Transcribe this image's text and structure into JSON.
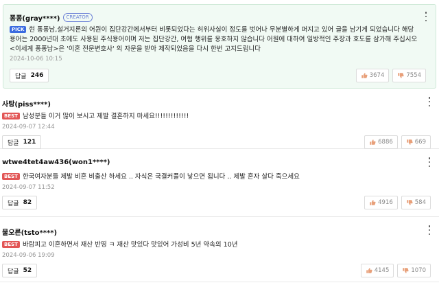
{
  "ui": {
    "reply_label": "답글"
  },
  "comments": [
    {
      "author": "퐁퐁(gray****)",
      "badge": "CREATOR",
      "tag": "PICK",
      "text": "현 퐁퐁남,설거지론의 어원이 집단강간에서부터 비롯되었다는 허위사실이 정도를 벗어나 무분별하게 퍼지고 있어 글을 남기게 되었습니다 해당용어는 2000년대 초에도 사용된 주식용어이며 저는 집단강간, 여혐 행위를 옹호하지 않습니다 어원에 대하여 일방적인 주장과 호도를 삼가해 주십시오 <이세계 퐁퐁남>은 '이혼 전문변호사' 의 자문을 받아 제작되었음을 다시 한번 고지드립니다",
      "date": "2024-10-06 10:15",
      "replies": "246",
      "likes": "3674",
      "dislikes": "7554"
    },
    {
      "author": "사탕(piss****)",
      "tag": "BEST",
      "text": "남성분들 이거 많이 보시고 제발 결혼하지 마세요!!!!!!!!!!!!!",
      "date": "2024-09-07 12:44",
      "replies": "121",
      "likes": "6886",
      "dislikes": "669"
    },
    {
      "author": "wtwe4tet4aw436(won1****)",
      "tag": "BEST",
      "text": "한국여자분들 제발 비혼 비출산 하세요 .. 자식은 국결커플이 낳으면 됩니다 .. 제발 혼자 살다 죽으세요",
      "date": "2024-09-07 11:52",
      "replies": "82",
      "likes": "4916",
      "dislikes": "584"
    },
    {
      "author": "물오른(tsto****)",
      "tag": "BEST",
      "text": "바람피고 이혼하면서 재산 반띵 ㅋ 재산 맛있다 맛있어 가성비 5년 약속의 10년",
      "date": "2024-09-06 19:09",
      "replies": "52",
      "likes": "4145",
      "dislikes": "1070"
    }
  ],
  "colors": {
    "pick": "#3b6be0",
    "best": "#e25656",
    "creator": "#6a7fd6",
    "pinned_bg": "#f1faf4"
  },
  "icons": {
    "like": "thumbs-up-icon",
    "dislike": "thumbs-down-icon",
    "more": "more-vertical-icon"
  }
}
